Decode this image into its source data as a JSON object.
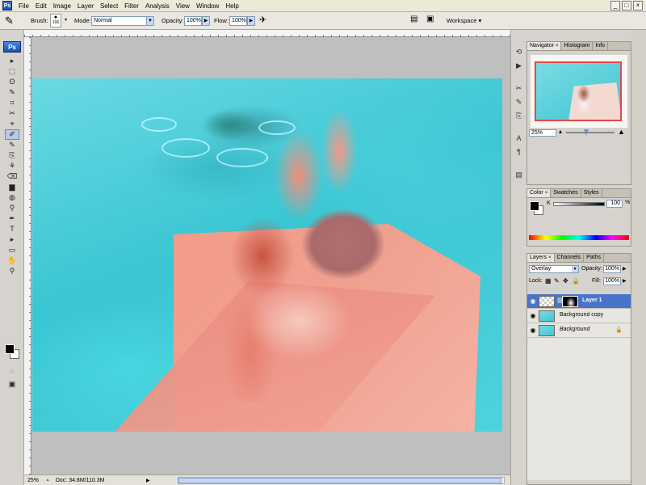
{
  "menubar": {
    "badge": "Ps",
    "items": [
      "File",
      "Edit",
      "Image",
      "Layer",
      "Select",
      "Filter",
      "Analysis",
      "View",
      "Window",
      "Help"
    ],
    "controls": [
      "_",
      "□",
      "×"
    ]
  },
  "options_bar": {
    "brush_label": "Brush:",
    "brush_size": "106",
    "mode_label": "Mode:",
    "mode_value": "Normal",
    "opacity_label": "Opacity:",
    "opacity_value": "100%",
    "flow_label": "Flow:",
    "flow_value": "100%",
    "workspace_label": "Workspace ▾"
  },
  "toolbox": {
    "logo": "Ps",
    "tools": [
      "▸",
      "⬚",
      "ʘ",
      "✎",
      "⌗",
      "✂",
      "⌖",
      "✐",
      "✎",
      "⎘",
      "⚘",
      "⌫",
      "▆",
      "◍",
      "⚲",
      "✒",
      "T",
      "▸",
      "▭",
      "✋",
      "⚲",
      "⬛",
      "◌",
      "▣"
    ]
  },
  "status_bar": {
    "zoom": "25%",
    "doc": "Doc: 34.8M/110.3M"
  },
  "navigator": {
    "tabs": [
      "Navigator",
      "Histogram",
      "Info"
    ],
    "zoom": "25%"
  },
  "color_panel": {
    "tabs": [
      "Color",
      "Swatches",
      "Styles"
    ],
    "channel": "K",
    "value": "100",
    "unit": "%"
  },
  "layers_panel": {
    "tabs": [
      "Layers",
      "Channels",
      "Paths"
    ],
    "blend_mode": "Overlay",
    "opacity_label": "Opacity:",
    "opacity_value": "100%",
    "lock_label": "Lock:",
    "fill_label": "Fill:",
    "fill_value": "100%",
    "layers": [
      {
        "name": "Layer 1",
        "selected": true
      },
      {
        "name": "Background copy",
        "selected": false
      },
      {
        "name": "Background",
        "selected": false
      }
    ],
    "footer_icons": [
      "link-icon",
      "fx-icon",
      "mask-icon",
      "adjustment-icon",
      "folder-icon",
      "new-layer-icon",
      "trash-icon"
    ]
  },
  "colors": {
    "accent": "#4a74c9",
    "canvas_water": "#3ecfd8",
    "overlay_red": "#f08e7c"
  }
}
